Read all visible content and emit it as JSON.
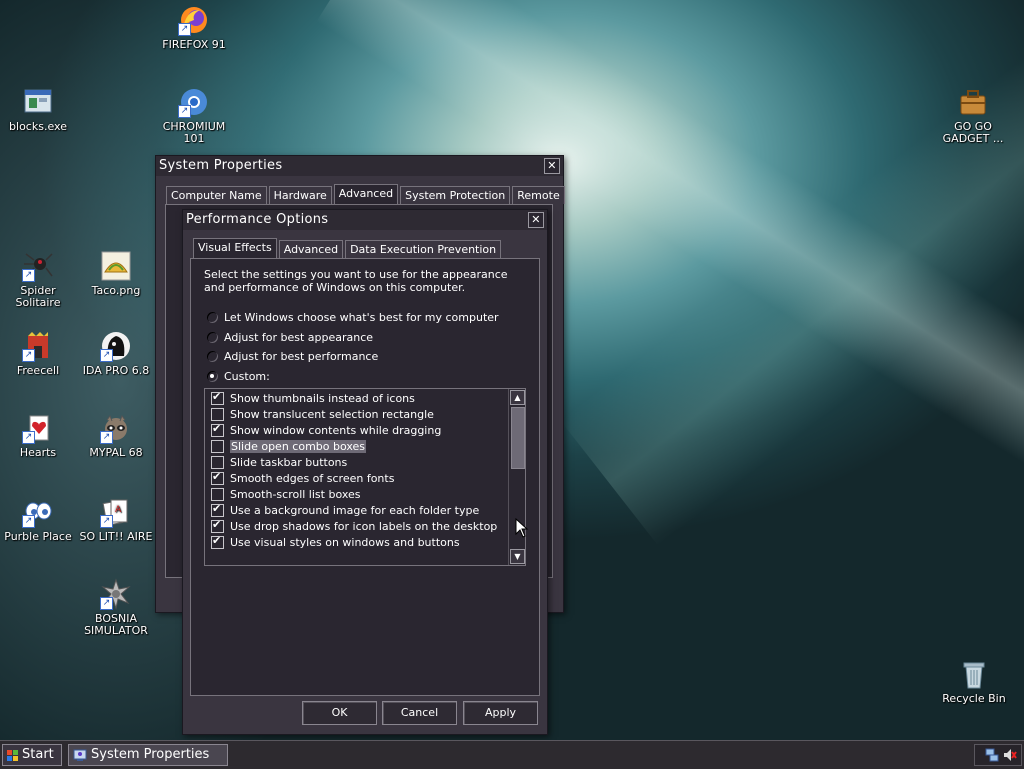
{
  "desktop": {
    "icons": [
      {
        "id": "firefox",
        "label": "FIREFOX 91"
      },
      {
        "id": "blocks",
        "label": "blocks.exe"
      },
      {
        "id": "chromium",
        "label": "CHROMIUM 101"
      },
      {
        "id": "gogo",
        "label": "GO GO GADGET ..."
      },
      {
        "id": "spider",
        "label": "Spider Solitaire"
      },
      {
        "id": "taco",
        "label": "Taco.png"
      },
      {
        "id": "freecell",
        "label": "Freecell"
      },
      {
        "id": "idapro",
        "label": "IDA PRO 6.8"
      },
      {
        "id": "hearts",
        "label": "Hearts"
      },
      {
        "id": "mypal",
        "label": "MYPAL 68"
      },
      {
        "id": "purble",
        "label": "Purble Place"
      },
      {
        "id": "solit",
        "label": "SO LIT!! AIRE"
      },
      {
        "id": "bosnia",
        "label": "BOSNIA SIMULATOR"
      },
      {
        "id": "recycle",
        "label": "Recycle Bin"
      }
    ]
  },
  "system_properties": {
    "title": "System Properties",
    "tabs": [
      "Computer Name",
      "Hardware",
      "Advanced",
      "System Protection",
      "Remote"
    ],
    "active_tab": "Advanced"
  },
  "performance_options": {
    "title": "Performance Options",
    "tabs": [
      "Visual Effects",
      "Advanced",
      "Data Execution Prevention"
    ],
    "active_tab": "Visual Effects",
    "description": "Select the settings you want to use for the appearance and performance of Windows on this computer.",
    "radios": [
      {
        "label": "Let Windows choose what's best for my computer",
        "checked": false
      },
      {
        "label": "Adjust for best appearance",
        "checked": false
      },
      {
        "label": "Adjust for best performance",
        "checked": false
      },
      {
        "label": "Custom:",
        "checked": true
      }
    ],
    "effects": [
      {
        "label": "Show thumbnails instead of icons",
        "checked": true,
        "selected": false
      },
      {
        "label": "Show translucent selection rectangle",
        "checked": false,
        "selected": false
      },
      {
        "label": "Show window contents while dragging",
        "checked": true,
        "selected": false
      },
      {
        "label": "Slide open combo boxes",
        "checked": false,
        "selected": true
      },
      {
        "label": "Slide taskbar buttons",
        "checked": false,
        "selected": false
      },
      {
        "label": "Smooth edges of screen fonts",
        "checked": true,
        "selected": false
      },
      {
        "label": "Smooth-scroll list boxes",
        "checked": false,
        "selected": false
      },
      {
        "label": "Use a background image for each folder type",
        "checked": true,
        "selected": false
      },
      {
        "label": "Use drop shadows for icon labels on the desktop",
        "checked": true,
        "selected": false
      },
      {
        "label": "Use visual styles on windows and buttons",
        "checked": true,
        "selected": false
      }
    ],
    "buttons": {
      "ok": "OK",
      "cancel": "Cancel",
      "apply": "Apply"
    }
  },
  "taskbar": {
    "start_label": "Start",
    "task_label": "System Properties"
  }
}
